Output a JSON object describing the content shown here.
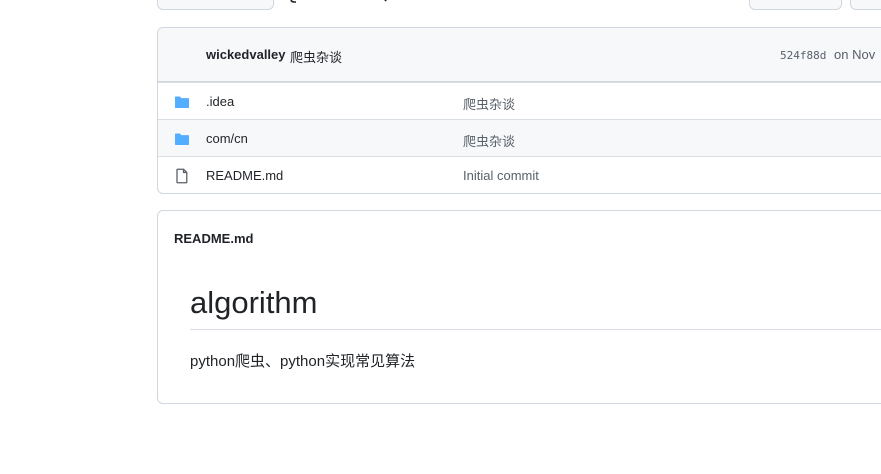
{
  "latest_commit": {
    "author": "wickedvalley",
    "message": "爬虫杂谈",
    "sha": "524f88d",
    "date": "on Nov"
  },
  "files": [
    {
      "name": ".idea",
      "type": "folder",
      "commit_message": "爬虫杂谈"
    },
    {
      "name": "com/cn",
      "type": "folder",
      "commit_message": "爬虫杂谈"
    },
    {
      "name": "README.md",
      "type": "file",
      "commit_message": "Initial commit"
    }
  ],
  "readme": {
    "filename": "README.md",
    "heading": "algorithm",
    "body": "python爬虫、python实现常见算法"
  },
  "colors": {
    "folder_icon": "#54aeff",
    "file_icon": "#57606a",
    "border": "#d0d7de",
    "header_bg": "#f6f8fa"
  }
}
